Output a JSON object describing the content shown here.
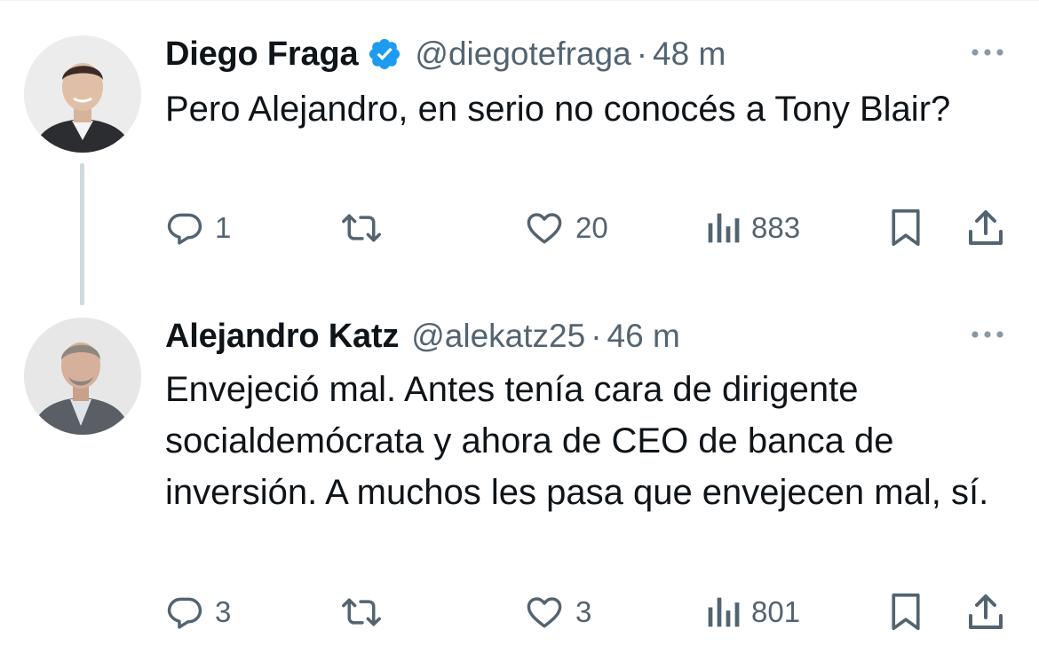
{
  "tweets": [
    {
      "display_name": "Diego Fraga",
      "verified": true,
      "handle": "@diegotefraga",
      "separator": "·",
      "time": "48 m",
      "text": "Pero Alejandro, en serio no conocés a Tony Blair?",
      "actions": {
        "replies": "1",
        "retweets": "",
        "likes": "20",
        "views": "883"
      }
    },
    {
      "display_name": "Alejandro Katz",
      "verified": false,
      "handle": "@alekatz25",
      "separator": "·",
      "time": "46 m",
      "text": "Envejeció mal. Antes tenía cara de dirigente socialdemócrata y ahora de CEO de banca de inversión. A muchos les pasa que envejecen mal, sí.",
      "actions": {
        "replies": "3",
        "retweets": "",
        "likes": "3",
        "views": "801"
      }
    }
  ],
  "icons": {
    "reply": "reply-icon",
    "retweet": "retweet-icon",
    "like": "heart-icon",
    "views": "views-icon",
    "bookmark": "bookmark-icon",
    "share": "share-icon",
    "more": "more-icon",
    "verified": "verified-badge-icon"
  },
  "colors": {
    "text_primary": "#0f1419",
    "text_secondary": "#536471",
    "verified_blue": "#1d9bf0",
    "thread_line": "#cfd9de"
  }
}
